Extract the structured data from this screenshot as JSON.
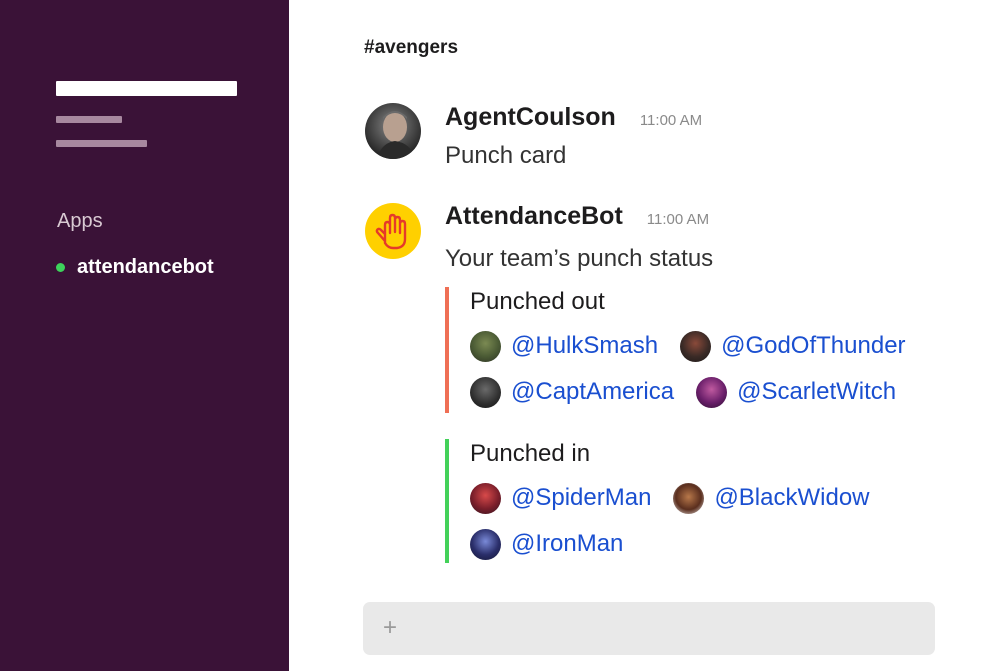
{
  "sidebar": {
    "section_label": "Apps",
    "apps": [
      {
        "label": "attendancebot",
        "status_color": "#3dd25b"
      }
    ]
  },
  "channel": {
    "title": "#avengers"
  },
  "messages": [
    {
      "sender": "AgentCoulson",
      "time": "11:00 AM",
      "text": "Punch card",
      "avatar": "user-photo-avatar"
    },
    {
      "sender": "AttendanceBot",
      "time": "11:00 AM",
      "text": "Your team’s punch status",
      "avatar": "hand-icon"
    }
  ],
  "sections": {
    "punched_out": {
      "title": "Punched out",
      "accent_color": "#ef6f55",
      "users": [
        "@HulkSmash",
        "@GodOfThunder",
        "@CaptAmerica",
        "@ScarletWitch"
      ]
    },
    "punched_in": {
      "title": "Punched in",
      "accent_color": "#43d159",
      "users": [
        "@SpiderMan",
        "@BlackWidow",
        "@IronMan"
      ]
    }
  },
  "composer": {
    "plus_icon": "+"
  },
  "colors": {
    "sidebar_bg": "#3a1237",
    "mention": "#1a4fd0",
    "bot_avatar": "#ffd000"
  }
}
